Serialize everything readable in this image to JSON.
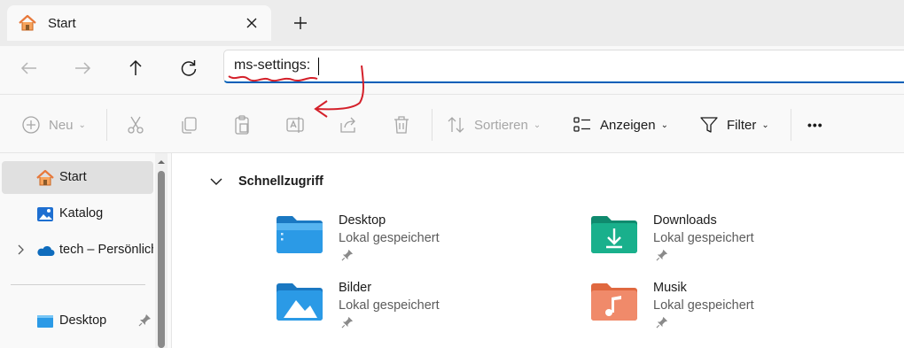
{
  "tabs": [
    {
      "label": "Start",
      "icon": "home-icon"
    }
  ],
  "nav": {
    "back_icon": "arrow-left-icon",
    "forward_icon": "arrow-right-icon",
    "up_icon": "arrow-up-icon",
    "refresh_icon": "refresh-icon",
    "address_value": "ms-settings:"
  },
  "commands": {
    "new_label": "Neu",
    "sort_label": "Sortieren",
    "view_label": "Anzeigen",
    "filter_label": "Filter",
    "more_label": "•••"
  },
  "sidebar": {
    "items": [
      {
        "label": "Start",
        "icon": "home-icon",
        "selected": true
      },
      {
        "label": "Katalog",
        "icon": "gallery-icon"
      },
      {
        "label": "tech – Persönlich",
        "icon": "onedrive-cloud-icon"
      },
      {
        "label": "Desktop",
        "icon": "desktop-folder-icon",
        "pinned": true
      }
    ]
  },
  "main": {
    "section_title": "Schnellzugriff",
    "quick_access": [
      {
        "name": "Desktop",
        "status": "Lokal gespeichert",
        "icon": "desktop-folder-icon"
      },
      {
        "name": "Downloads",
        "status": "Lokal gespeichert",
        "icon": "downloads-folder-icon"
      },
      {
        "name": "Bilder",
        "status": "Lokal gespeichert",
        "icon": "pictures-folder-icon"
      },
      {
        "name": "Musik",
        "status": "Lokal gespeichert",
        "icon": "music-folder-icon"
      }
    ]
  },
  "colors": {
    "accent": "#005fb8",
    "annotation": "#d4202a"
  }
}
